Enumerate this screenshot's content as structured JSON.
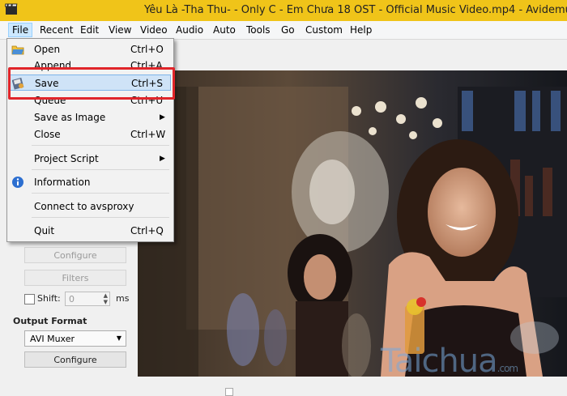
{
  "window": {
    "title": "Yêu Là -Tha Thu- - Only C - Em Chưa 18 OST - Official Music Video.mp4 - Avidemux"
  },
  "menubar": [
    "File",
    "Recent",
    "Edit",
    "View",
    "Video",
    "Audio",
    "Auto",
    "Tools",
    "Go",
    "Custom",
    "Help"
  ],
  "file_menu": {
    "open": {
      "label": "Open",
      "shortcut": "Ctrl+O"
    },
    "append": {
      "label": "Append",
      "shortcut": "Ctrl+A"
    },
    "save": {
      "label": "Save",
      "shortcut": "Ctrl+S"
    },
    "queue": {
      "label": "Queue",
      "shortcut": "Ctrl+U"
    },
    "save_as_image": {
      "label": "Save as Image"
    },
    "close": {
      "label": "Close",
      "shortcut": "Ctrl+W"
    },
    "project_script": {
      "label": "Project Script"
    },
    "information": {
      "label": "Information"
    },
    "connect": {
      "label": "Connect to avsproxy"
    },
    "quit": {
      "label": "Quit",
      "shortcut": "Ctrl+Q"
    }
  },
  "left_panel": {
    "configure_disabled": "Configure",
    "filters": "Filters",
    "shift_label": "Shift:",
    "shift_value": "0",
    "shift_unit": "ms",
    "output_format_label": "Output Format",
    "output_format_value": "AVI Muxer",
    "configure": "Configure"
  },
  "watermark": {
    "text": "Taichua",
    "tld": ".com"
  },
  "colors": {
    "title_bar": "#f0c419",
    "highlight": "#e0252a",
    "menu_active": "#cce8ff"
  }
}
